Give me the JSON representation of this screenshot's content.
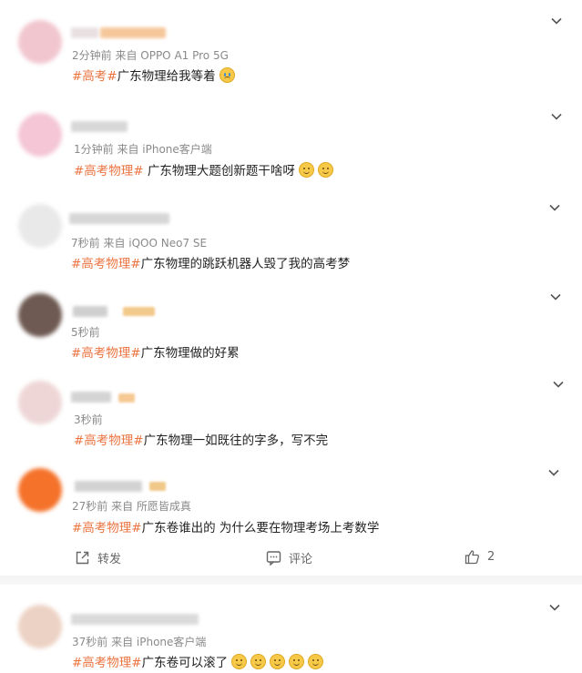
{
  "comments": [
    {
      "meta": "2分钟前  来自 OPPO A1 Pro 5G",
      "tag": "#高考#",
      "body": "广东物理给我等着",
      "emojis": [
        "cry"
      ],
      "avatar_color": "#f1c6cf",
      "name_colors": [
        "#e9e0e2",
        "#f5c79a"
      ]
    },
    {
      "meta": "1分钟前  来自 iPhone客户端",
      "tag": "#高考物理#",
      "body": " 广东物理大题创新题干啥呀",
      "emojis": [
        "smile",
        "smile"
      ],
      "avatar_color": "#f4c6d6",
      "name_colors": [
        "#d8d8d8",
        "#cfcfcf"
      ]
    },
    {
      "meta": "7秒前  来自 iQOO Neo7 SE",
      "tag": "#高考物理#",
      "body": "广东物理的跳跃机器人毁了我的高考梦",
      "emojis": [],
      "avatar_color": "#e9e9e9",
      "name_colors": [
        "#d6d6d6",
        "#e1e1e1"
      ]
    },
    {
      "meta": "5秒前",
      "tag": "#高考物理#",
      "body": "广东物理做的好累",
      "emojis": [],
      "avatar_color": "#6e5a52",
      "name_colors": [
        "#cfcfcf",
        "#f3c98b"
      ]
    },
    {
      "meta": "3秒前",
      "tag": "#高考物理#",
      "body": "广东物理一如既往的字多，写不完",
      "emojis": [],
      "avatar_color": "#efd6d6",
      "name_colors": [
        "#d4d4d4",
        "#f6c993"
      ]
    },
    {
      "meta": "27秒前  来自 所愿皆成真",
      "tag": "#高考物理#",
      "body": "广东卷谁出的 为什么要在物理考场上考数学",
      "emojis": [],
      "avatar_color": "#f5722a",
      "name_colors": [
        "#d2d2d2",
        "#f0c888"
      ]
    },
    {
      "meta": "37秒前  来自 iPhone客户端",
      "tag": "#高考物理#",
      "body": "广东卷可以滚了",
      "emojis": [
        "smile",
        "smile",
        "smile",
        "smile",
        "smile"
      ],
      "avatar_color": "#ecd2c4",
      "name_colors": [
        "#dadada",
        "#e8e0d8"
      ]
    }
  ],
  "actions": {
    "repost": "转发",
    "comment": "评论",
    "like_count": "2"
  }
}
